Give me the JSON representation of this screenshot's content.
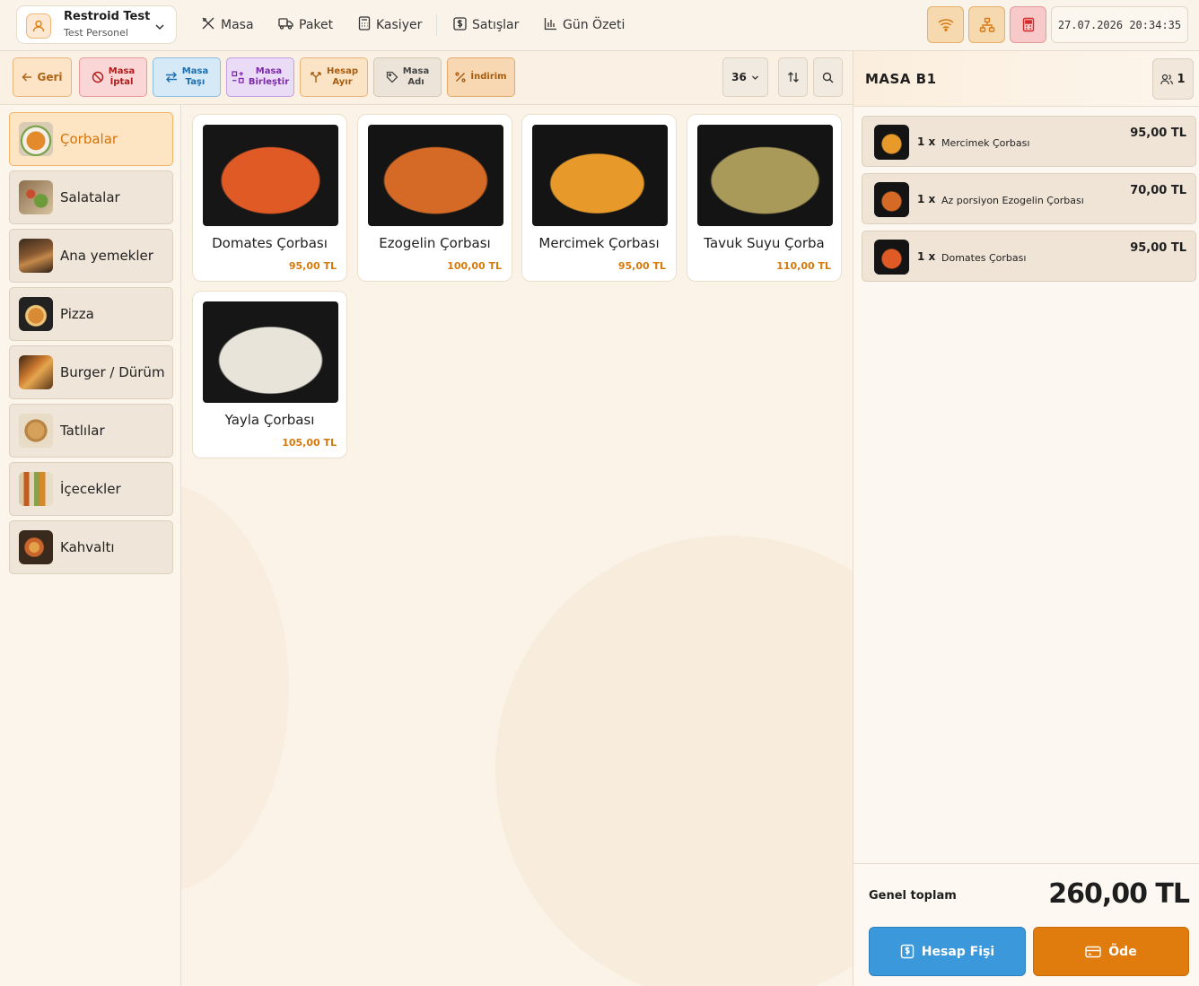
{
  "profile": {
    "name": "Restroid Test",
    "role": "Test Personel",
    "icon": "user-icon"
  },
  "nav": [
    {
      "label": "Masa",
      "icon": "utensils-icon"
    },
    {
      "label": "Paket",
      "icon": "truck-icon"
    },
    {
      "label": "Kasiyer",
      "icon": "calculator-icon"
    },
    {
      "label": "Satışlar",
      "icon": "dollar-icon"
    },
    {
      "label": "Gün Özeti",
      "icon": "bar-chart-icon"
    }
  ],
  "toolbar": {
    "datetime": "27.07.2026 20:34:35"
  },
  "actions": {
    "back": "Geri",
    "cancel_l1": "Masa",
    "cancel_l2": "İptal",
    "move_l1": "Masa",
    "move_l2": "Taşı",
    "merge_l1": "Masa",
    "merge_l2": "Birleştir",
    "split_l1": "Hesap",
    "split_l2": "Ayır",
    "rename_l1": "Masa",
    "rename_l2": "Adı",
    "discount": "İndirim",
    "size_value": "36"
  },
  "categories": [
    {
      "label": "Çorbalar",
      "active": true
    },
    {
      "label": "Salatalar"
    },
    {
      "label": "Ana yemekler"
    },
    {
      "label": "Pizza"
    },
    {
      "label": "Burger / Dürüm"
    },
    {
      "label": "Tatlılar"
    },
    {
      "label": "İçecekler"
    },
    {
      "label": "Kahvaltı"
    }
  ],
  "products": [
    {
      "name": "Domates Çorbası",
      "price": "95,00 TL"
    },
    {
      "name": "Ezogelin Çorbası",
      "price": "100,00 TL"
    },
    {
      "name": "Mercimek Çorbası",
      "price": "95,00 TL"
    },
    {
      "name": "Tavuk Suyu Çorba",
      "price": "110,00 TL"
    },
    {
      "name": "Yayla Çorbası",
      "price": "105,00 TL"
    }
  ],
  "order": {
    "title": "MASA B1",
    "guests": "1",
    "items": [
      {
        "qty": "1 x",
        "name": "Mercimek Çorbası",
        "price": "95,00 TL"
      },
      {
        "qty": "1 x",
        "name": "Az porsiyon Ezogelin Çorbası",
        "price": "70,00 TL"
      },
      {
        "qty": "1 x",
        "name": "Domates Çorbası",
        "price": "95,00 TL"
      }
    ],
    "total_label": "Genel toplam",
    "total": "260,00 TL",
    "receipt_button": "Hesap Fişi",
    "pay_button": "Öde"
  },
  "colors": {
    "accent": "#e07b0d",
    "price": "#d67a0c",
    "blue": "#3a98db"
  }
}
